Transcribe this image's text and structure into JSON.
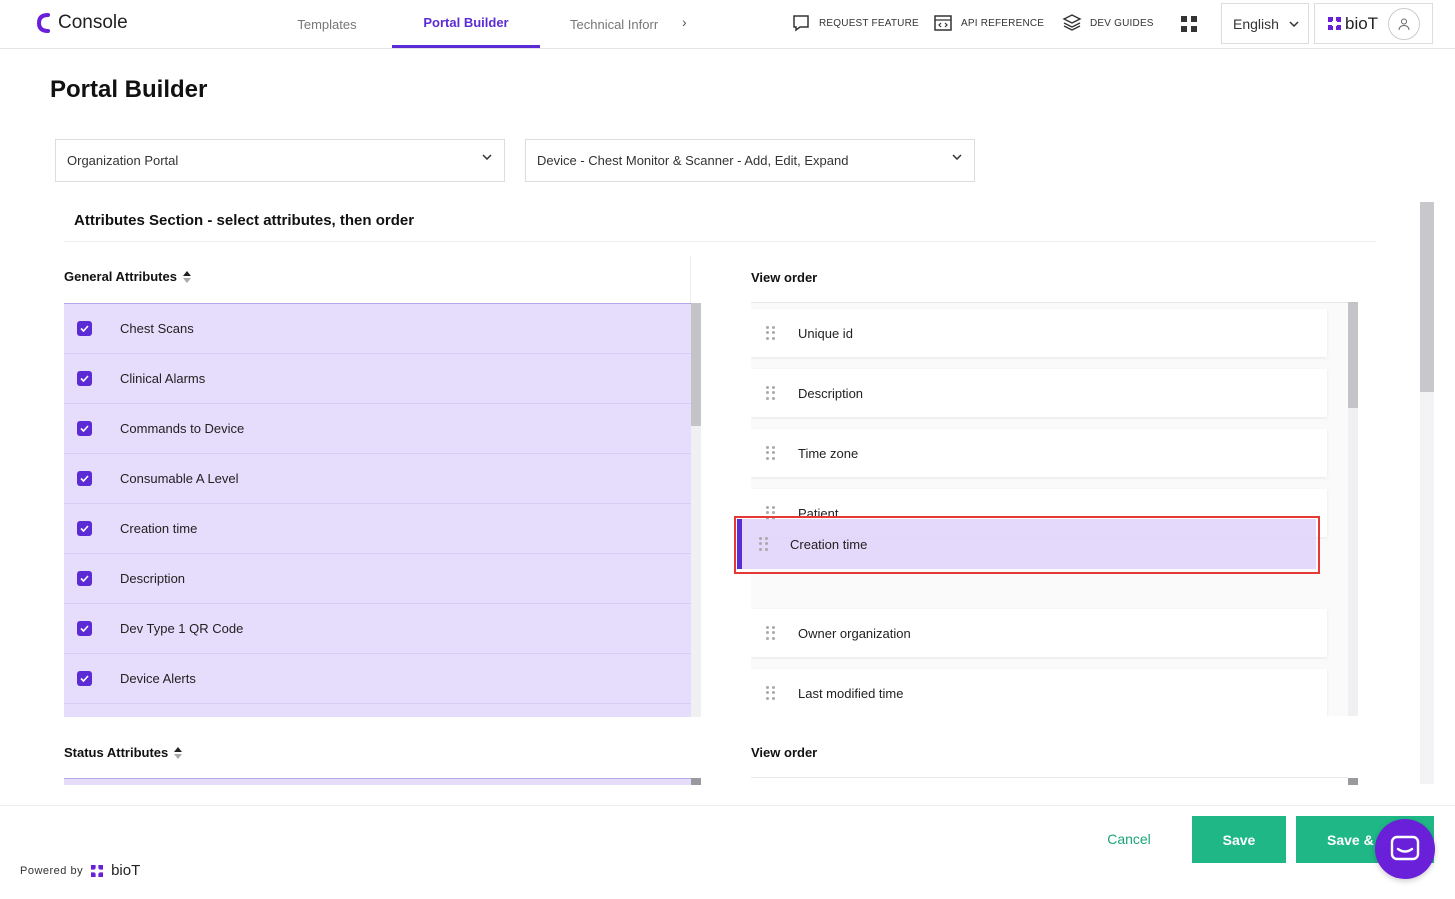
{
  "app": {
    "name": "Console"
  },
  "nav": {
    "tabs": [
      {
        "label": "Templates",
        "active": false
      },
      {
        "label": "Portal Builder",
        "active": true
      },
      {
        "label": "Technical Inforr",
        "active": false
      }
    ],
    "links": {
      "request_feature": "REQUEST FEATURE",
      "api_reference": "API REFERENCE",
      "dev_guides": "DEV GUIDES"
    },
    "language": "English",
    "brand": "bioT"
  },
  "page": {
    "title": "Portal Builder",
    "portal_select": "Organization Portal",
    "view_select": "Device - Chest Monitor & Scanner - Add, Edit, Expand",
    "section_title": "Attributes Section - select attributes, then order"
  },
  "general": {
    "header": "General Attributes",
    "items": [
      {
        "label": "Chest Scans",
        "checked": true
      },
      {
        "label": "Clinical Alarms",
        "checked": true
      },
      {
        "label": "Commands to Device",
        "checked": true
      },
      {
        "label": "Consumable A Level",
        "checked": true
      },
      {
        "label": "Creation time",
        "checked": true
      },
      {
        "label": "Description",
        "checked": true
      },
      {
        "label": "Dev Type 1 QR Code",
        "checked": true
      },
      {
        "label": "Device Alerts",
        "checked": true
      }
    ],
    "view_order_header": "View order",
    "view_order": [
      "Unique id",
      "Description",
      "Time zone",
      "Patient",
      "Owner organization",
      "Last modified time"
    ],
    "dragging": "Creation time"
  },
  "status": {
    "header": "Status Attributes",
    "view_order_header": "View order"
  },
  "footer": {
    "cancel": "Cancel",
    "save": "Save",
    "save_next": "Save & N",
    "powered_by": "Powered by",
    "brand": "bioT"
  },
  "colors": {
    "accent": "#5b2bd6",
    "selected_bg": "#e6dcfb",
    "save_green": "#1fb786",
    "drag_outline": "#e53935"
  }
}
